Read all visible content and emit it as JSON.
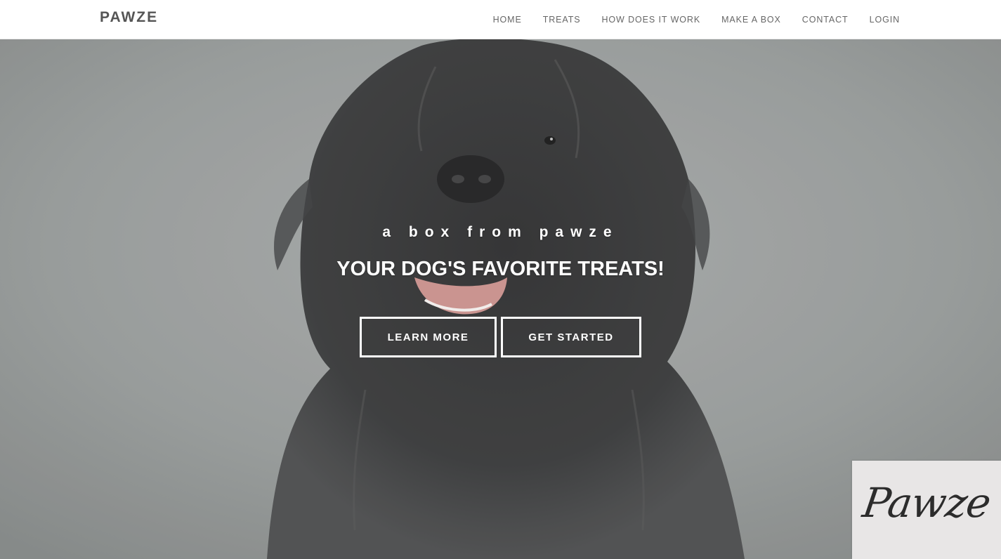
{
  "navbar": {
    "brand": "PAWZE",
    "links": [
      {
        "label": "HOME"
      },
      {
        "label": "TREATS"
      },
      {
        "label": "HOW DOES IT WORK"
      },
      {
        "label": "MAKE A BOX"
      },
      {
        "label": "CONTACT"
      },
      {
        "label": "LOGIN"
      }
    ]
  },
  "hero": {
    "tagline": "a box from pawze",
    "title": "YOUR DOG'S FAVORITE TREATS!",
    "learn_more_label": "LEARN MORE",
    "get_started_label": "GET STARTED"
  },
  "logo_badge": {
    "text": "Pawze"
  },
  "colors": {
    "nav_background": "#ffffff",
    "nav_text": "#666666",
    "brand_text": "#555555",
    "hero_background": "#8f9392",
    "hero_text": "#ffffff",
    "badge_background": "#e8e6e6"
  }
}
